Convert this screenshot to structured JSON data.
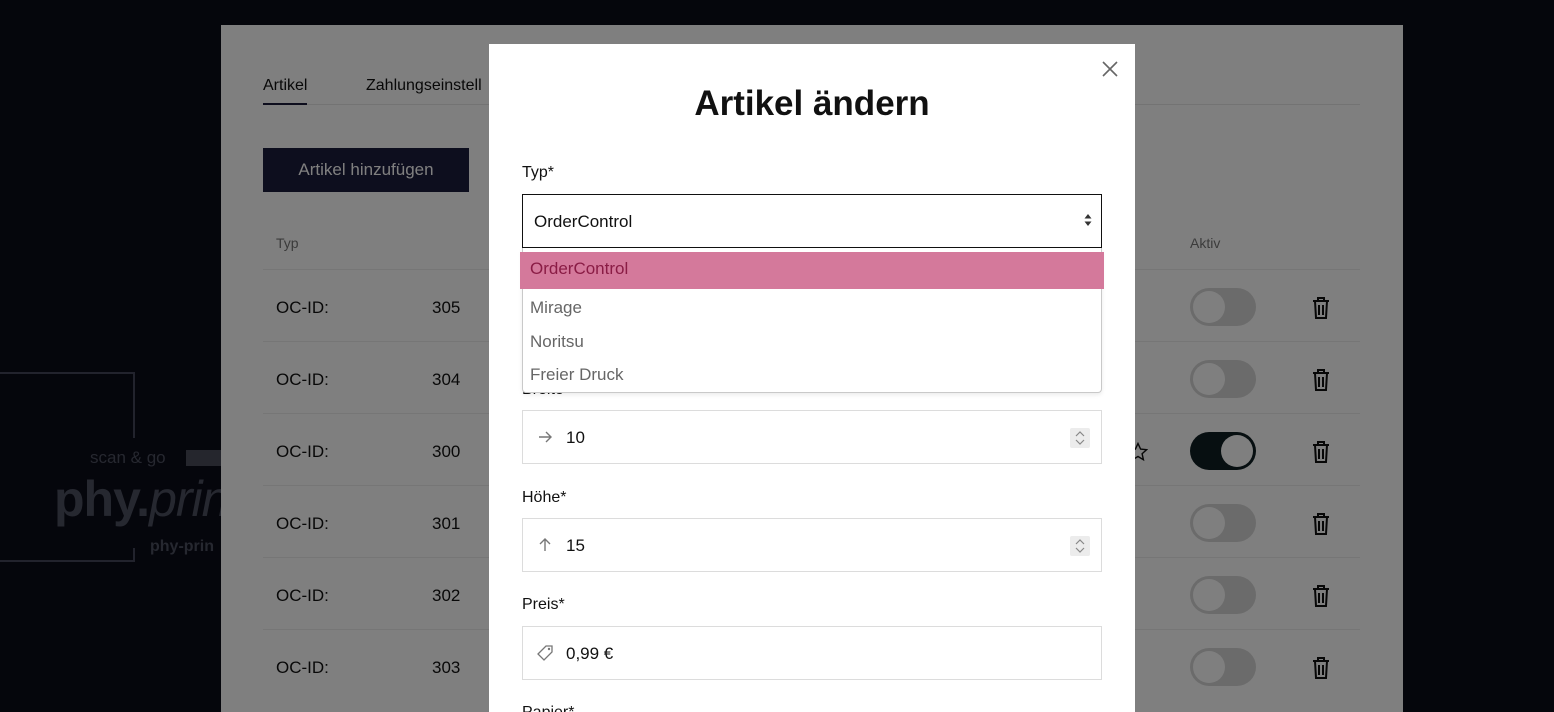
{
  "logo": {
    "tagline": "scan & go",
    "brand_bold": "phy.",
    "brand_italic": "prin",
    "sub": "phy-prin"
  },
  "tabs": [
    {
      "label": "Artikel"
    },
    {
      "label": "Zahlungseinstell"
    }
  ],
  "add_button": "Artikel hinzufügen",
  "table": {
    "headers": {
      "typ": "Typ",
      "aktiv": "Aktiv"
    },
    "rows": [
      {
        "label": "OC-ID:",
        "id": "305",
        "active": false
      },
      {
        "label": "OC-ID:",
        "id": "304",
        "active": false
      },
      {
        "label": "OC-ID:",
        "id": "300",
        "active": true
      },
      {
        "label": "OC-ID:",
        "id": "301",
        "active": false
      },
      {
        "label": "OC-ID:",
        "id": "302",
        "active": false
      },
      {
        "label": "OC-ID:",
        "id": "303",
        "active": false
      }
    ]
  },
  "modal": {
    "title": "Artikel ändern",
    "typ_label": "Typ*",
    "typ_value": "OrderControl",
    "typ_options": [
      "OrderControl",
      "Mirage",
      "Noritsu",
      "Freier Druck"
    ],
    "breite_label_fragment": "Breite",
    "breite_value": "10",
    "hoehe_label": "Höhe*",
    "hoehe_value": "15",
    "preis_label": "Preis*",
    "preis_value": "0,99 €",
    "papier_label": "Papier*"
  },
  "colors": {
    "background": "#0b0c18",
    "accent": "#1b1c3c",
    "selected_option": "#d4799b",
    "toggle_on": "#0f1f22"
  }
}
